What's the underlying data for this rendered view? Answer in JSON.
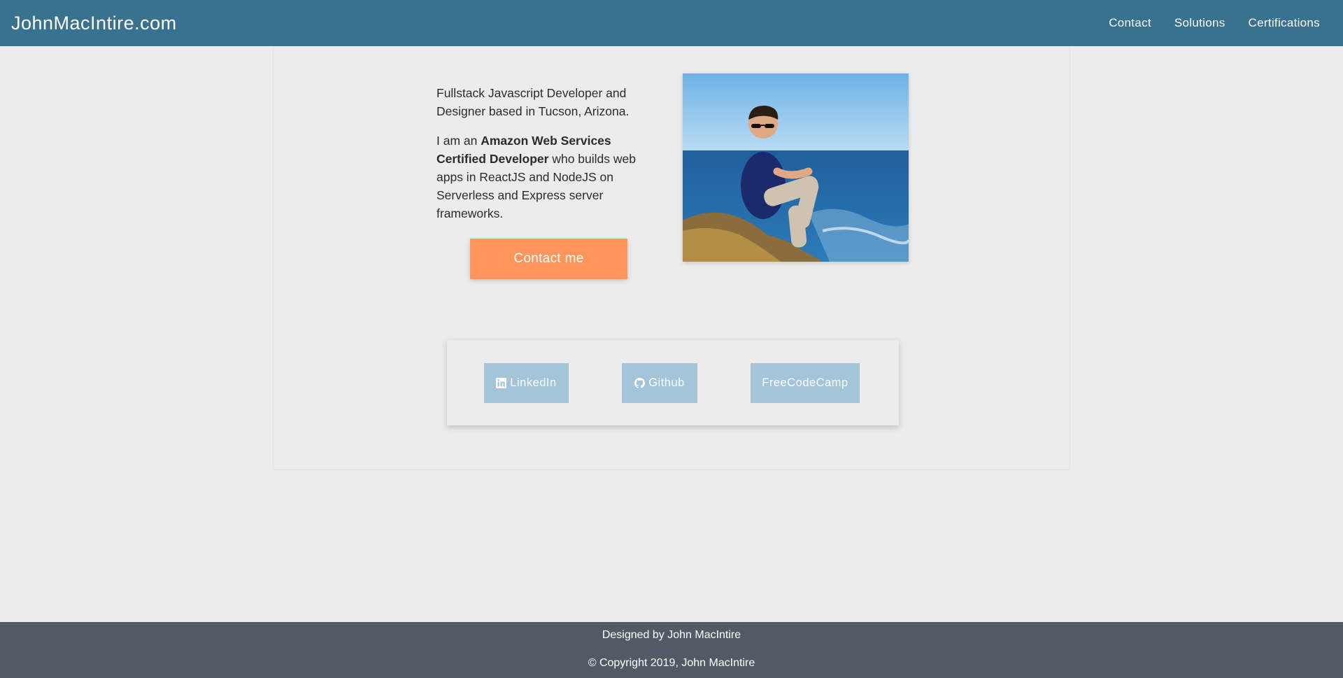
{
  "header": {
    "brand": "JohnMacIntire.com",
    "nav": [
      {
        "label": "Contact"
      },
      {
        "label": "Solutions"
      },
      {
        "label": "Certifications"
      }
    ]
  },
  "intro": {
    "line1": "Fullstack Javascript Developer and Designer based in Tucson, Arizona.",
    "line2_prefix": "I am an ",
    "line2_bold": "Amazon Web Services Certified Developer",
    "line2_suffix": " who builds web apps in ReactJS and NodeJS on Serverless and Express server frameworks."
  },
  "contact_button": {
    "label": "Contact me"
  },
  "social": {
    "linkedin": {
      "label": "LinkedIn",
      "icon": "linkedin-icon"
    },
    "github": {
      "label": "Github",
      "icon": "github-icon"
    },
    "freecodecamp": {
      "label": "FreeCodeCamp"
    }
  },
  "footer": {
    "designed_by": "Designed by John MacIntire",
    "copyright": "© Copyright 2019, John MacIntire"
  },
  "colors": {
    "header": "#38728f",
    "accent": "#ff955b",
    "social_button": "#a3c4d9",
    "footer": "#525a63",
    "background": "#ececec"
  }
}
